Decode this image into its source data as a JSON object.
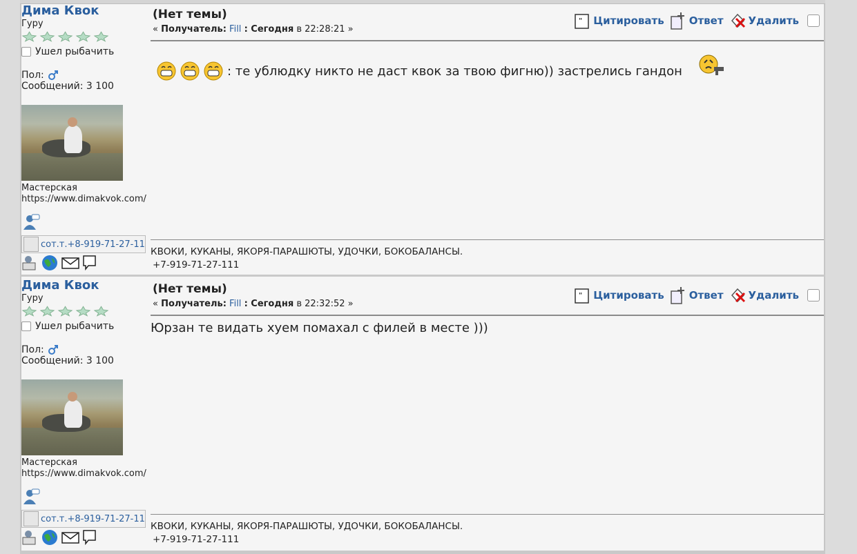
{
  "posts": [
    {
      "author": "Дима Квок",
      "rank": "Гуру",
      "status": "Ушел рыбачить",
      "gender_label": "Пол:",
      "posts_count": "Сообщений: 3 100",
      "workshop": "Мастерская",
      "website": "https://www.dimakvok.com/",
      "image_alt": "сот.т.+8-919-71-27-111",
      "subject": "(Нет темы)",
      "meta_prefix": "«",
      "recipient_label": "Получатель:",
      "recipient": "Fill",
      "date_label": ": Сегодня",
      "time": "в 22:28:21",
      "meta_suffix": "»",
      "body": ": те ублюдку никто не даст квок за твою фигню))  застрелись гандон",
      "signature_line1": "КВОКИ, КУКАНЫ, ЯКОРЯ-ПАРАШЮТЫ, УДОЧКИ, БОКОБАЛАНСЫ.",
      "signature_line2": "+7-919-71-27-111"
    },
    {
      "author": "Дима Квок",
      "rank": "Гуру",
      "status": "Ушел рыбачить",
      "gender_label": "Пол:",
      "posts_count": "Сообщений: 3 100",
      "workshop": "Мастерская",
      "website": "https://www.dimakvok.com/",
      "image_alt": "сот.т.+8-919-71-27-111",
      "subject": "(Нет темы)",
      "meta_prefix": "«",
      "recipient_label": "Получатель:",
      "recipient": "Fill",
      "date_label": ": Сегодня",
      "time": "в 22:32:52",
      "meta_suffix": "»",
      "body": "Юрзан те видать хуем помахал с филей в месте )))",
      "signature_line1": "КВОКИ, КУКАНЫ, ЯКОРЯ-ПАРАШЮТЫ, УДОЧКИ, БОКОБАЛАНСЫ.",
      "signature_line2": "+7-919-71-27-111"
    }
  ],
  "actions": {
    "quote": "Цитировать",
    "reply": "Ответ",
    "delete": "Удалить"
  },
  "colors": {
    "link": "#2b5f9e",
    "background": "#f5f5f5"
  }
}
